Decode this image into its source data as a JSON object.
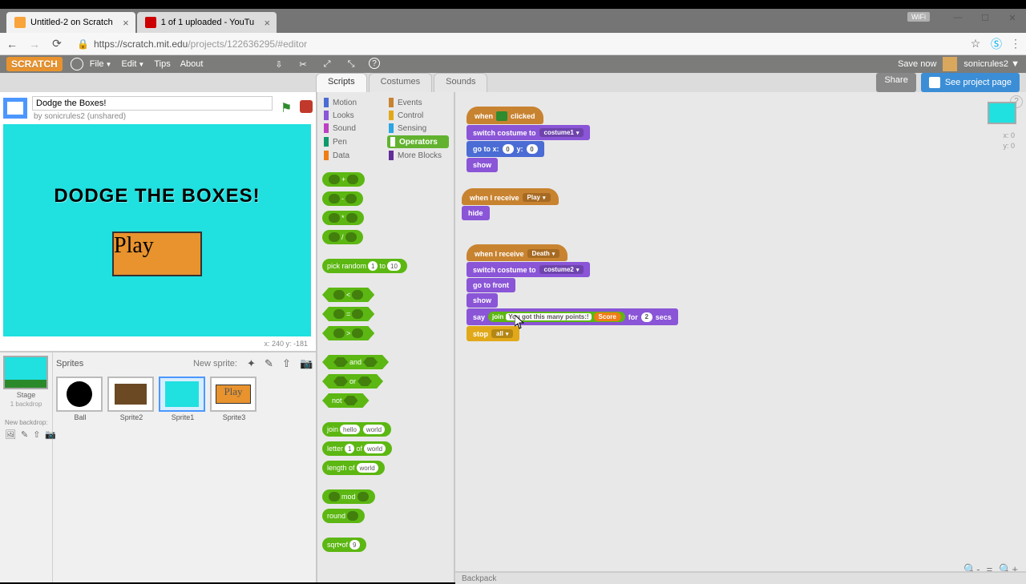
{
  "browser": {
    "tabs": [
      {
        "title": "Untitled-2 on Scratch",
        "active": true
      },
      {
        "title": "1 of 1 uploaded - YouTu",
        "active": false
      }
    ],
    "url_host": "https://scratch.mit.edu",
    "url_path": "/projects/122636295/#editor",
    "wifi": "WiFi"
  },
  "topbar": {
    "logo": "SCRATCH",
    "menus": {
      "file": "File",
      "edit": "Edit",
      "tips": "Tips",
      "about": "About"
    },
    "save_now": "Save now",
    "username": "sonicrules2"
  },
  "project": {
    "title": "Dodge the Boxes!",
    "byline": "by sonicrules2 (unshared)"
  },
  "stage": {
    "title": "DODGE THE BOXES!",
    "play": "Play",
    "coords": "x: 240  y: -181"
  },
  "sprites_panel": {
    "sprites_label": "Sprites",
    "new_sprite": "New sprite:",
    "stage_label": "Stage",
    "stage_sub": "1 backdrop",
    "new_backdrop": "New backdrop:",
    "items": [
      {
        "name": "Ball"
      },
      {
        "name": "Sprite2"
      },
      {
        "name": "Sprite1"
      },
      {
        "name": "Sprite3"
      }
    ]
  },
  "tabs": {
    "scripts": "Scripts",
    "costumes": "Costumes",
    "sounds": "Sounds"
  },
  "header_right": {
    "share": "Share",
    "see_page": "See project page"
  },
  "categories": {
    "motion": "Motion",
    "looks": "Looks",
    "sound": "Sound",
    "pen": "Pen",
    "data": "Data",
    "events": "Events",
    "control": "Control",
    "sensing": "Sensing",
    "operators": "Operators",
    "more": "More Blocks"
  },
  "palette": {
    "pick_random": "pick random",
    "to": "to",
    "pr_a": "1",
    "pr_b": "10",
    "and": "and",
    "or": "or",
    "not": "not",
    "join": "join",
    "hello": "hello",
    "world": "world",
    "letter": "letter",
    "letter_n": "1",
    "of": "of",
    "length_of": "length of",
    "mod": "mod",
    "round": "round",
    "sqrt": "sqrt",
    "sqrt_n": "9"
  },
  "scripts": {
    "when_clicked": "when",
    "clicked_suffix": "clicked",
    "switch_costume": "switch costume to",
    "costume1": "costume1",
    "costume2": "costume2",
    "goto_xy": "go to x:",
    "gy": "y:",
    "gx_v": "0",
    "gy_v": "0",
    "show": "show",
    "hide": "hide",
    "when_receive": "when I receive",
    "msg_play": "Play",
    "msg_death": "Death",
    "go_front": "go to front",
    "say": "say",
    "join": "join",
    "say_txt": "You got this many points:!",
    "score": "Score",
    "for": "for",
    "secs": "secs",
    "sec_v": "2",
    "stop": "stop",
    "stop_all": "all"
  },
  "readout": {
    "x": "x: 0",
    "y": "y: 0"
  },
  "backpack": "Backpack"
}
